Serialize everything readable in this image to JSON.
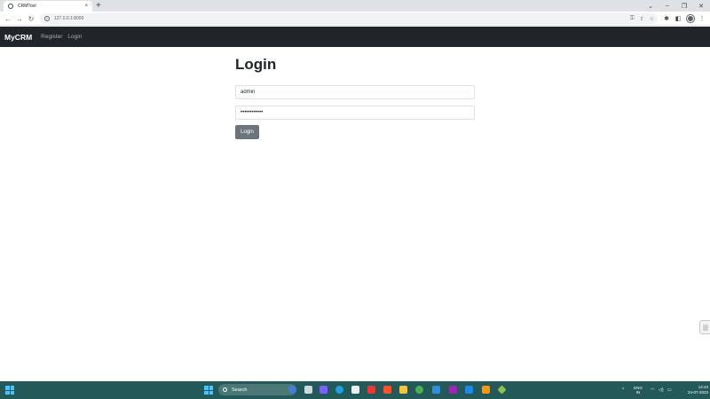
{
  "browser": {
    "tab_title": "CRMTool",
    "tab_close": "×",
    "new_tab": "+",
    "url": "127.0.0.1:8000",
    "window_controls": [
      "⌄",
      "–",
      "❐",
      "✕"
    ]
  },
  "navbar": {
    "brand": "MyCRM",
    "links": [
      "Register",
      "Login"
    ]
  },
  "login": {
    "title": "Login",
    "username_value": "admin",
    "password_value": "••••••••••••",
    "button_label": "Login"
  },
  "taskbar": {
    "search_label": "Search",
    "language": [
      "ENG",
      "IN"
    ],
    "time": "14:43",
    "date": "24-07-2023"
  },
  "colors": {
    "navbar_bg": "#212529",
    "button_bg": "#6c757d",
    "taskbar_bg": "#24595a",
    "tabstrip_bg": "#dee1e6"
  }
}
